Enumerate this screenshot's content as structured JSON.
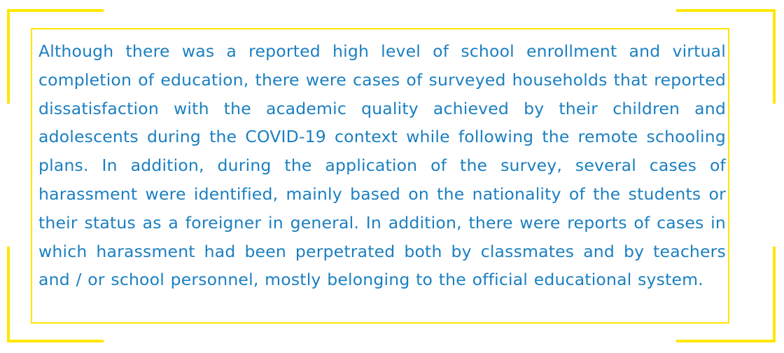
{
  "callout": {
    "text": "Although there was a reported high level of school enrollment and virtual completion of education, there were cases of surveyed households that reported dissatisfaction with the academic quality achieved by their children and adolescents during the COVID-19 context while following the remote schooling plans. In addition, during the application of the survey, several cases of harassment were identified, mainly based on the nationality of the students or their status as a foreigner in general. In addition, there were reports of cases in which harassment had been perpetrated both by classmates and by teachers and / or school personnel, mostly belonging to the official educational system."
  },
  "colors": {
    "text": "#1b7fc0",
    "frame": "#ffe600",
    "background": "#ffffff"
  }
}
